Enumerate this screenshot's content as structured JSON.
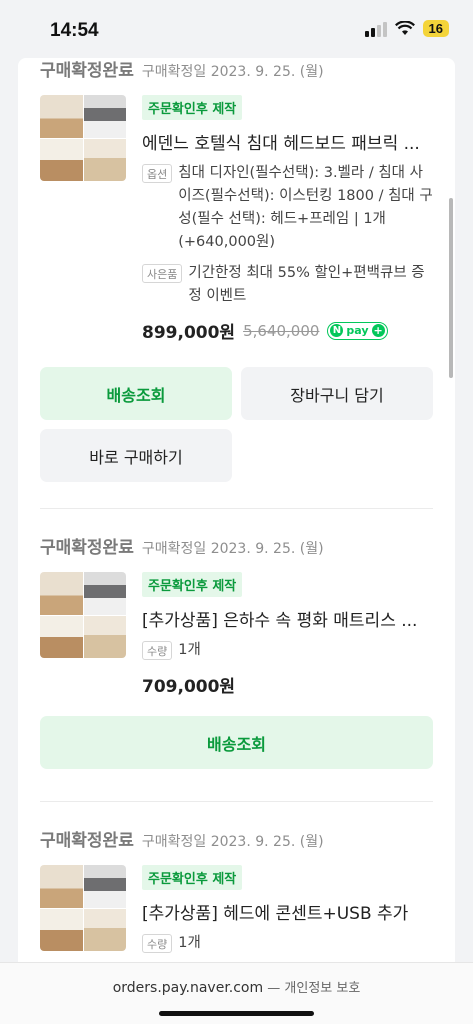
{
  "status_bar": {
    "time": "14:54",
    "battery": "16"
  },
  "orders": [
    {
      "status": "구매확정완료",
      "confirm_date": "구매확정일 2023. 9. 25. (월)",
      "badge": "주문확인후 제작",
      "name": "에덴느 호텔식 침대 헤드보드 패브릭 ...",
      "options": [
        {
          "tag": "옵션",
          "text": "침대 디자인(필수선택): 3.벨라 / 침대 사이즈(필수선택): 이스턴킹 1800 / 침대 구성(필수 선택): 헤드+프레임 | 1개 (+640,000원)"
        },
        {
          "tag": "사은품",
          "text": "기간한정 최대 55% 할인+편백큐브 증정 이벤트"
        }
      ],
      "price": "899,000원",
      "original_price": "5,640,000",
      "buttons": [
        "배송조회",
        "장바구니 담기",
        "바로 구매하기"
      ]
    },
    {
      "status": "구매확정완료",
      "confirm_date": "구매확정일 2023. 9. 25. (월)",
      "badge": "주문확인후 제작",
      "name": "[추가상품] 은하수 속 평화 매트리스 ...",
      "options": [
        {
          "tag": "수량",
          "text": "1개"
        }
      ],
      "price": "709,000원",
      "buttons": [
        "배송조회"
      ]
    },
    {
      "status": "구매확정완료",
      "confirm_date": "구매확정일 2023. 9. 25. (월)",
      "badge": "주문확인후 제작",
      "name": "[추가상품] 헤드에 콘센트+USB 추가",
      "options": [
        {
          "tag": "수량",
          "text": "1개"
        }
      ]
    }
  ],
  "npay": {
    "n": "N",
    "pay": "pay",
    "plus": "+"
  },
  "bottom_bar": {
    "domain": "orders.pay.naver.com",
    "separator": " — ",
    "privacy": "개인정보 보호"
  }
}
